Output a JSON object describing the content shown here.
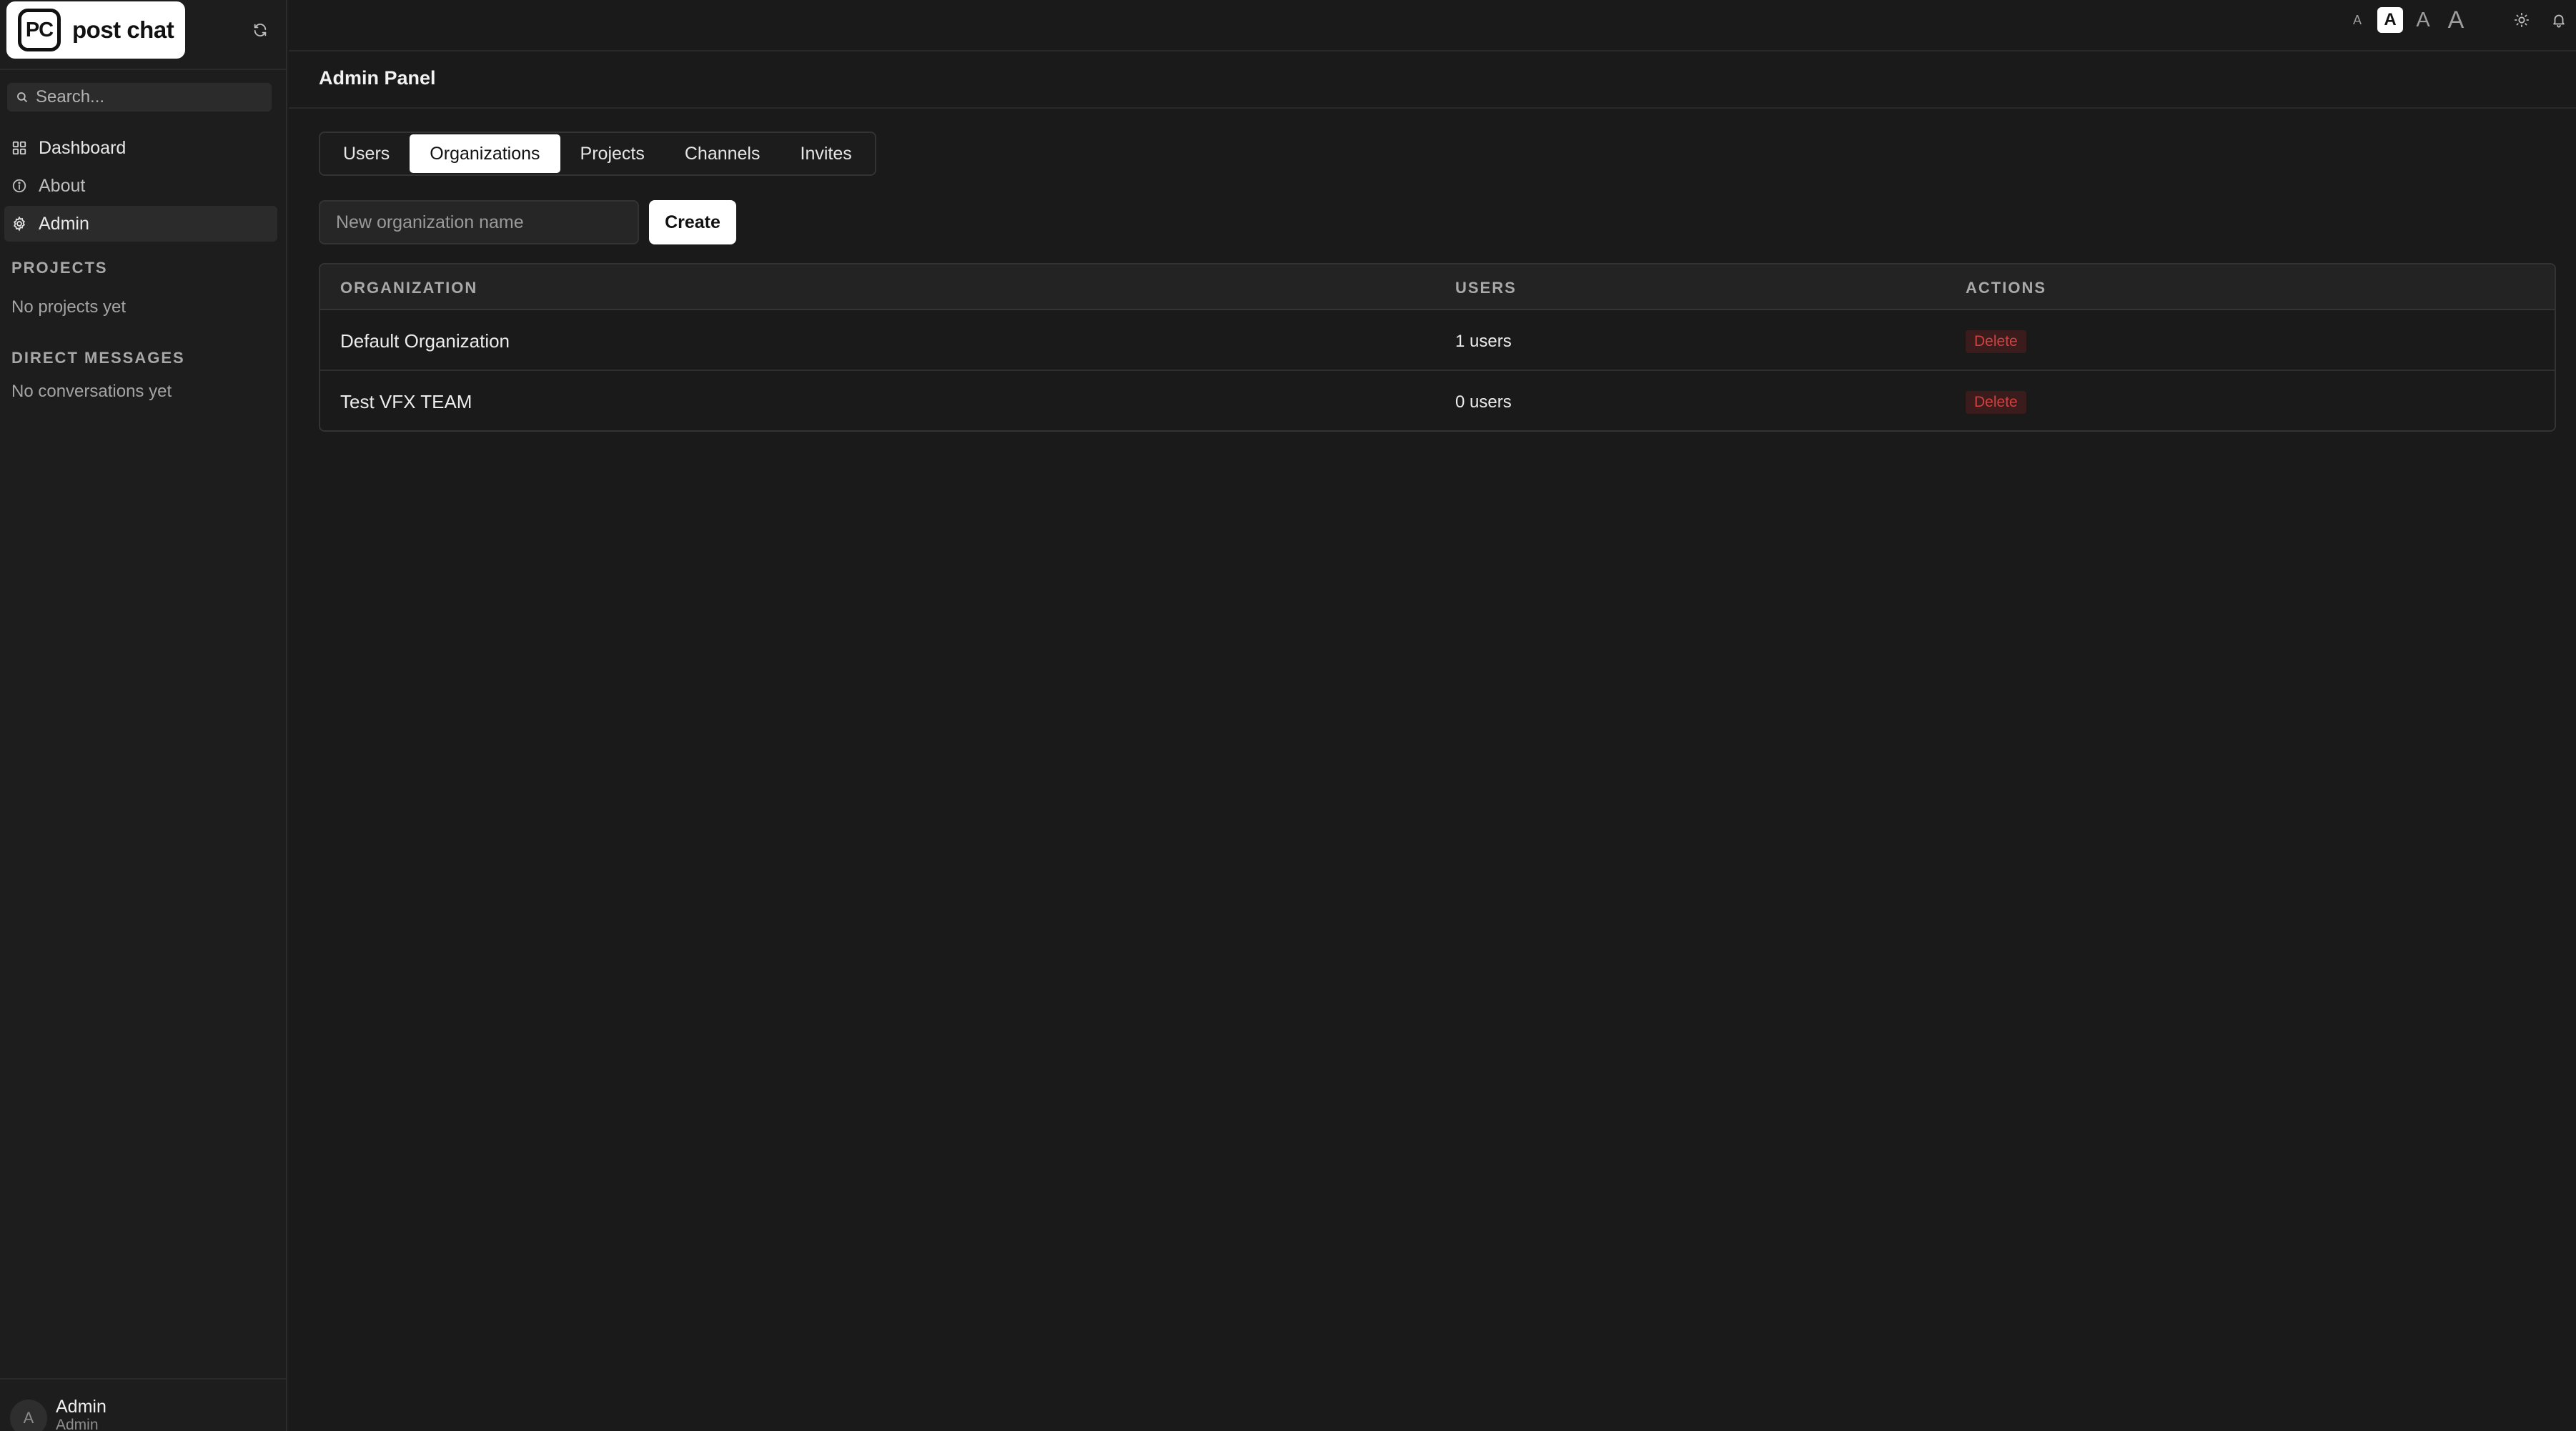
{
  "app": {
    "logo_mark": "PC",
    "logo_text": "post chat"
  },
  "sidebar": {
    "search_placeholder": "Search...",
    "nav": [
      {
        "label": "Dashboard",
        "icon": "grid-icon"
      },
      {
        "label": "About",
        "icon": "info-icon"
      },
      {
        "label": "Admin",
        "icon": "gear-icon",
        "active": true
      }
    ],
    "projects_title": "PROJECTS",
    "projects_empty": "No projects yet",
    "dm_title": "DIRECT MESSAGES",
    "dm_empty": "No conversations yet",
    "user": {
      "initial": "A",
      "name": "Admin",
      "role": "Admin"
    }
  },
  "topbar": {
    "font_sizes": [
      "A",
      "A",
      "A",
      "A"
    ],
    "active_font_size_index": 1
  },
  "main": {
    "title": "Admin Panel",
    "tabs": [
      "Users",
      "Organizations",
      "Projects",
      "Channels",
      "Invites"
    ],
    "active_tab": "Organizations",
    "new_org_placeholder": "New organization name",
    "create_label": "Create",
    "table": {
      "headers": [
        "ORGANIZATION",
        "USERS",
        "ACTIONS"
      ],
      "rows": [
        {
          "organization": "Default Organization",
          "users": "1 users",
          "action": "Delete"
        },
        {
          "organization": "Test VFX TEAM",
          "users": "0 users",
          "action": "Delete"
        }
      ]
    }
  },
  "colors": {
    "background": "#1a1a1a",
    "sidebar": "#1d1d1d",
    "accent_active": "#ffffff",
    "danger": "#d24040"
  }
}
